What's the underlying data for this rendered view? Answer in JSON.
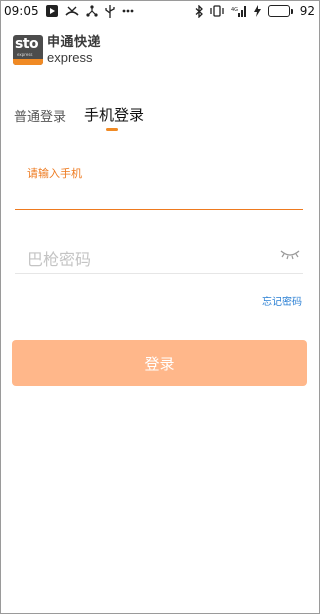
{
  "status_bar": {
    "time": "09:05",
    "battery_level": "92",
    "battery_fraction": 0.92,
    "icons_left": [
      "play-icon",
      "missed-call-icon",
      "share-icon",
      "usb-icon",
      "more-icon"
    ],
    "icons_right": [
      "bluetooth-icon",
      "vibrate-icon",
      "signal-icon",
      "charging-icon",
      "battery-icon"
    ],
    "battery_color": "#3cc43c"
  },
  "logo": {
    "badge_text": "sto",
    "badge_subtext": "express",
    "name_cn": "申通快递",
    "name_en": "express"
  },
  "tabs": [
    {
      "label": "普通登录",
      "active": false
    },
    {
      "label": "手机登录",
      "active": true
    }
  ],
  "phone_field": {
    "label": "请输入手机",
    "value": ""
  },
  "password_field": {
    "placeholder": "巴枪密码",
    "value": ""
  },
  "forgot_password": "忘记密码",
  "login_button": "登录",
  "colors": {
    "accent": "#ee7a1f",
    "button": "#ffb78a",
    "link": "#2a7fd4"
  }
}
